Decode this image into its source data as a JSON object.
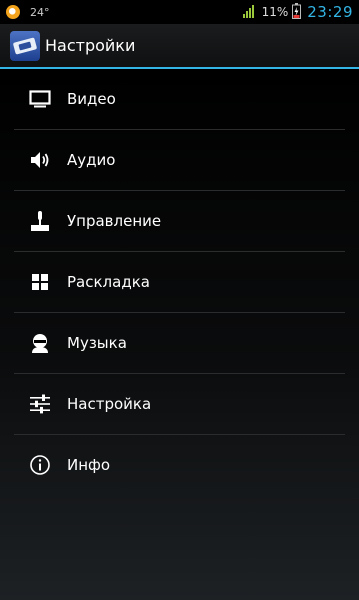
{
  "status_bar": {
    "temperature": "24°",
    "battery_percent": "11%",
    "time": "23:29",
    "icons": [
      "weather-notification-icon",
      "signal-icon",
      "battery-charging-icon"
    ]
  },
  "action_bar": {
    "title": "Настройки",
    "app_icon": "app-ticket-icon"
  },
  "menu": {
    "items": [
      {
        "label": "Видео",
        "icon": "monitor-icon"
      },
      {
        "label": "Аудио",
        "icon": "speaker-icon"
      },
      {
        "label": "Управление",
        "icon": "joystick-icon"
      },
      {
        "label": "Раскладка",
        "icon": "layout-grid-icon"
      },
      {
        "label": "Музыка",
        "icon": "user-headphones-icon"
      },
      {
        "label": "Настройка",
        "icon": "sliders-icon"
      },
      {
        "label": "Инфо",
        "icon": "info-icon"
      }
    ]
  },
  "colors": {
    "accent": "#33b5e5",
    "background": "#000000",
    "text": "#ffffff"
  }
}
